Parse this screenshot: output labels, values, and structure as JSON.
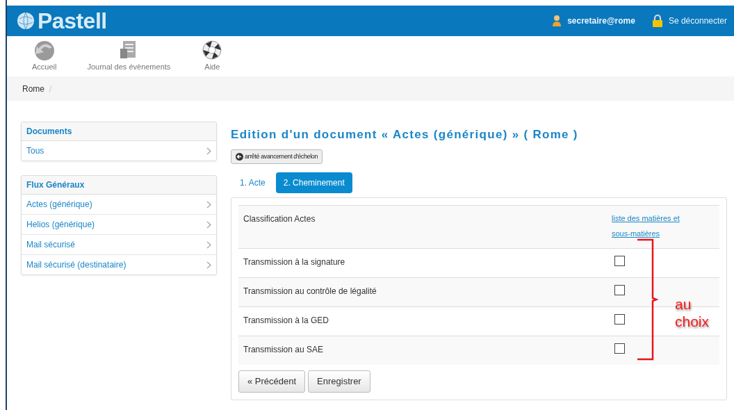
{
  "header": {
    "logo": "Pastell",
    "user": "secretaire@rome",
    "logout": "Se déconnecter"
  },
  "toolbar": [
    {
      "label": "Accueil",
      "kind": "home"
    },
    {
      "label": "Journal des évènements",
      "kind": "journal"
    },
    {
      "label": "Aide",
      "kind": "help"
    }
  ],
  "breadcrumb": [
    "Rome"
  ],
  "sidebar": [
    {
      "title": "Documents",
      "items": [
        "Tous"
      ]
    },
    {
      "title": "Flux Généraux",
      "items": [
        "Actes (générique)",
        "Helios (générique)",
        "Mail sécurisé",
        "Mail sécurisé (destinataire)"
      ]
    }
  ],
  "page_title": "Edition d'un document « Actes (générique) » ( Rome )",
  "back_button": "arrêté avancement d'échelon",
  "tabs": [
    {
      "label": "1. Acte",
      "selected": false
    },
    {
      "label": "2. Cheminement",
      "selected": true
    }
  ],
  "form": {
    "header_label": "Classification Actes",
    "header_link": "liste des matières et sous-matières",
    "rows": [
      {
        "label": "Transmission à la signature",
        "checked": false
      },
      {
        "label": "Transmission au contrôle de légalité",
        "checked": false
      },
      {
        "label": "Transmission à la GED",
        "checked": false
      },
      {
        "label": "Transmission au SAE",
        "checked": false
      }
    ]
  },
  "buttons": [
    "« Précédent",
    "Enregistrer"
  ],
  "annotation": "au choix"
}
